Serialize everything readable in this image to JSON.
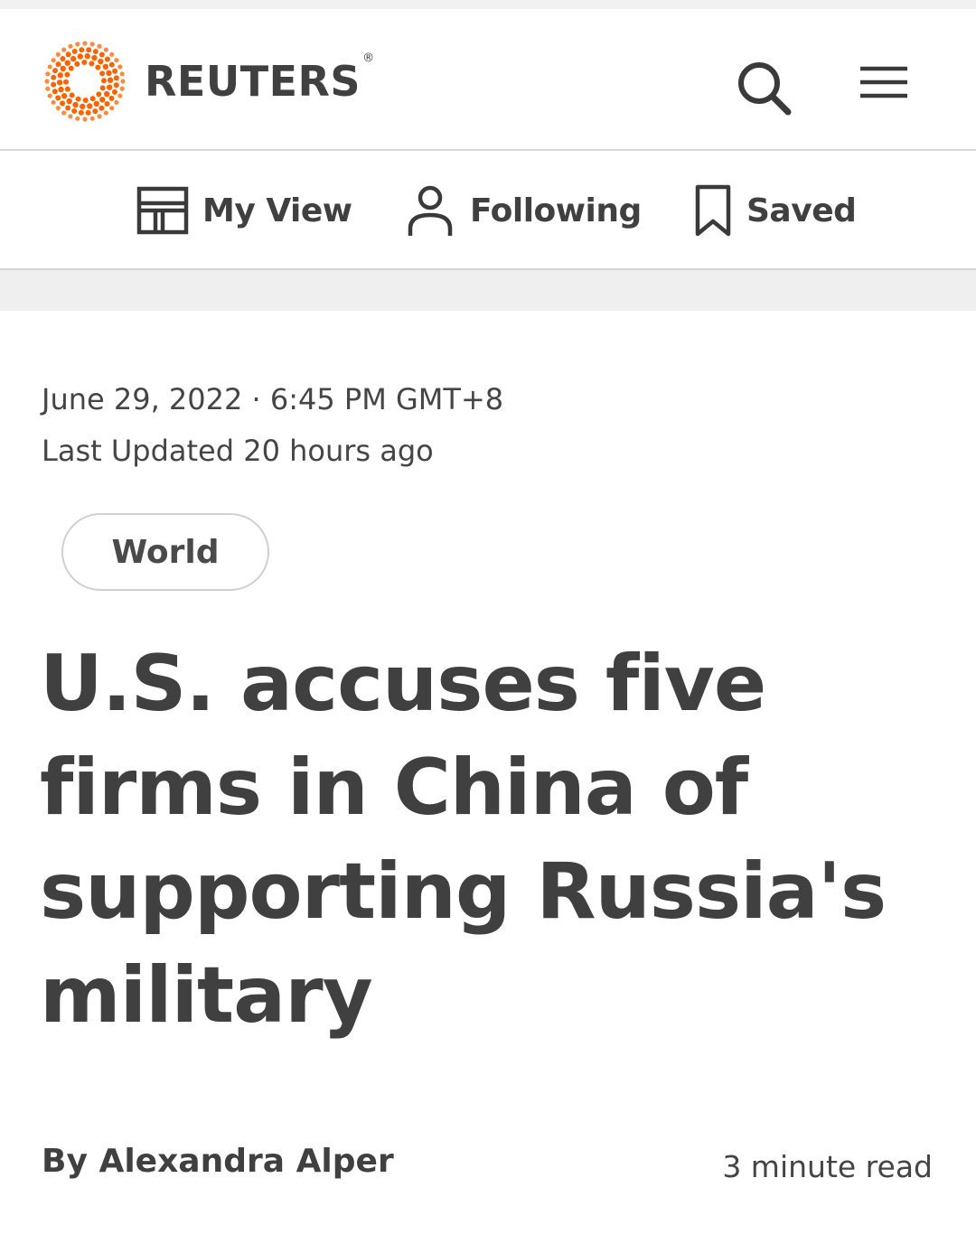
{
  "header": {
    "brand": "REUTERS",
    "registered": "®",
    "brand_color": "#fa6400",
    "search_icon": "search-icon",
    "menu_icon": "hamburger-menu-icon"
  },
  "nav": {
    "items": [
      {
        "label": "My View",
        "icon": "layout-icon"
      },
      {
        "label": "Following",
        "icon": "person-icon"
      },
      {
        "label": "Saved",
        "icon": "bookmark-icon"
      }
    ]
  },
  "article": {
    "date": "June 29, 2022 · 6:45 PM GMT+8",
    "last_updated": "Last Updated 20 hours ago",
    "tag": "World",
    "headline": "U.S. accuses five firms in China of supporting Russia's military",
    "byline_prefix": "By",
    "author": "Alexandra Alper",
    "read_time": "3 minute read"
  }
}
